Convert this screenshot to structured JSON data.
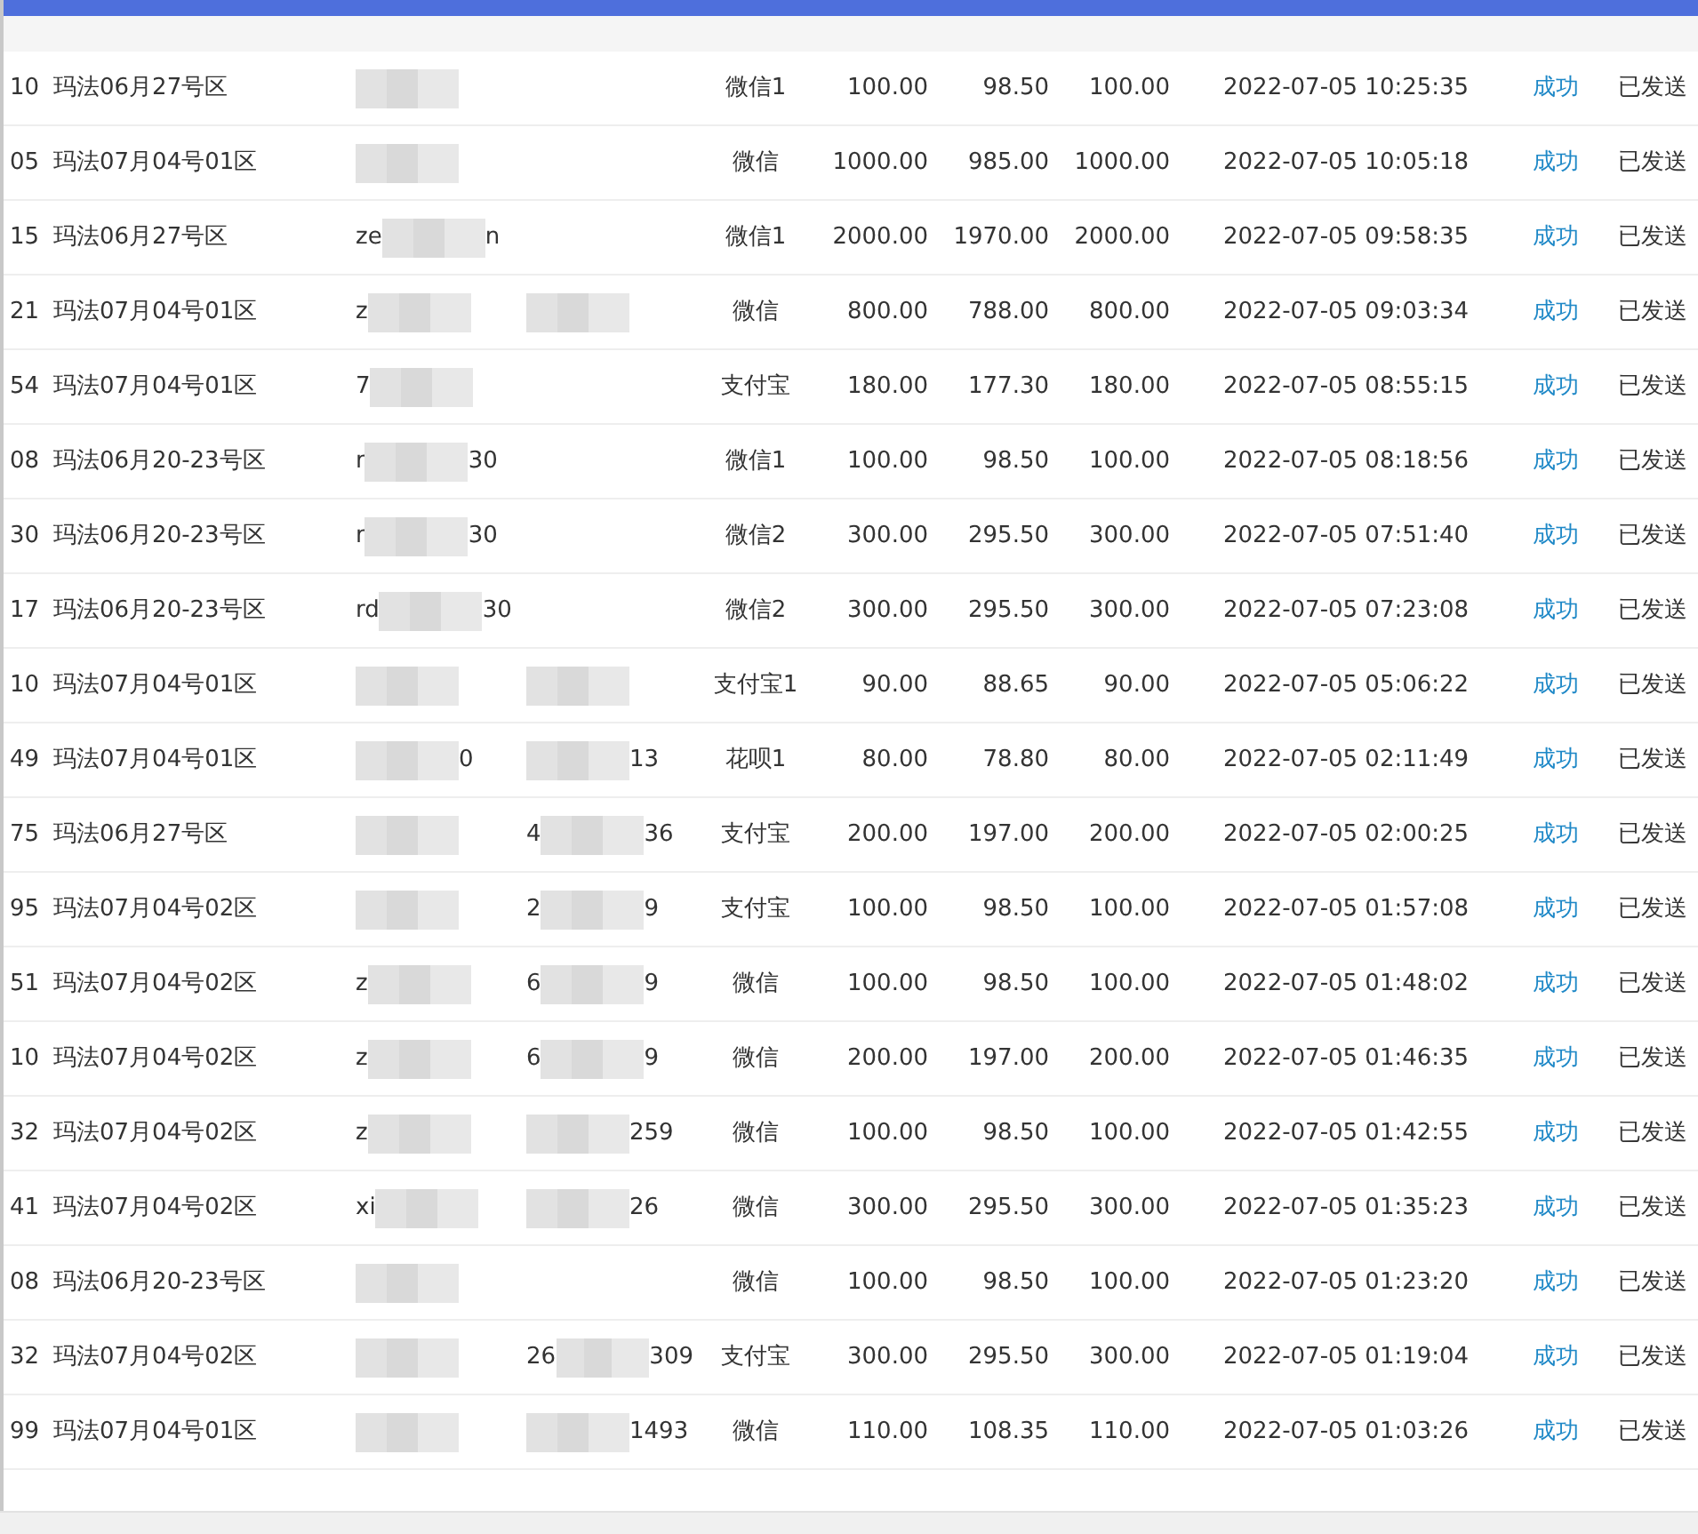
{
  "rows": [
    {
      "id": "10",
      "zone": "玛法06月27号区",
      "account": {
        "masked": true
      },
      "method": "微信1",
      "amount": "100.00",
      "actual": "98.50",
      "paid": "100.00",
      "time": "2022-07-05 10:25:35",
      "status": "成功",
      "notify": "已发送"
    },
    {
      "id": "05",
      "zone": "玛法07月04号01区",
      "account": {
        "masked": true
      },
      "method": "微信",
      "amount": "1000.00",
      "actual": "985.00",
      "paid": "1000.00",
      "time": "2022-07-05 10:05:18",
      "status": "成功",
      "notify": "已发送"
    },
    {
      "id": "15",
      "zone": "玛法06月27号区",
      "account": {
        "start": "ze",
        "end": "n",
        "masked": true
      },
      "method": "微信1",
      "amount": "2000.00",
      "actual": "1970.00",
      "paid": "2000.00",
      "time": "2022-07-05 09:58:35",
      "status": "成功",
      "notify": "已发送"
    },
    {
      "id": "21",
      "zone": "玛法07月04号01区",
      "account": {
        "start": "z",
        "masked": true
      },
      "phone": {
        "masked": true
      },
      "method": "微信",
      "amount": "800.00",
      "actual": "788.00",
      "paid": "800.00",
      "time": "2022-07-05 09:03:34",
      "status": "成功",
      "notify": "已发送"
    },
    {
      "id": "54",
      "zone": "玛法07月04号01区",
      "account": {
        "start": "7",
        "masked": true
      },
      "method": "支付宝",
      "amount": "180.00",
      "actual": "177.30",
      "paid": "180.00",
      "time": "2022-07-05 08:55:15",
      "status": "成功",
      "notify": "已发送"
    },
    {
      "id": "08",
      "zone": "玛法06月20-23号区",
      "account": {
        "start": "r",
        "end": "30",
        "masked": true
      },
      "method": "微信1",
      "amount": "100.00",
      "actual": "98.50",
      "paid": "100.00",
      "time": "2022-07-05 08:18:56",
      "status": "成功",
      "notify": "已发送"
    },
    {
      "id": "30",
      "zone": "玛法06月20-23号区",
      "account": {
        "start": "r",
        "end": "30",
        "masked": true
      },
      "method": "微信2",
      "amount": "300.00",
      "actual": "295.50",
      "paid": "300.00",
      "time": "2022-07-05 07:51:40",
      "status": "成功",
      "notify": "已发送"
    },
    {
      "id": "17",
      "zone": "玛法06月20-23号区",
      "account": {
        "start": "rd",
        "end": "30",
        "masked": true
      },
      "method": "微信2",
      "amount": "300.00",
      "actual": "295.50",
      "paid": "300.00",
      "time": "2022-07-05 07:23:08",
      "status": "成功",
      "notify": "已发送"
    },
    {
      "id": "10",
      "zone": "玛法07月04号01区",
      "account": {
        "masked": true
      },
      "phone": {
        "masked": true
      },
      "method": "支付宝1",
      "amount": "90.00",
      "actual": "88.65",
      "paid": "90.00",
      "time": "2022-07-05 05:06:22",
      "status": "成功",
      "notify": "已发送"
    },
    {
      "id": "49",
      "zone": "玛法07月04号01区",
      "account": {
        "end": "0",
        "masked": true
      },
      "phone": {
        "end": "13",
        "masked": true
      },
      "method": "花呗1",
      "amount": "80.00",
      "actual": "78.80",
      "paid": "80.00",
      "time": "2022-07-05 02:11:49",
      "status": "成功",
      "notify": "已发送"
    },
    {
      "id": "75",
      "zone": "玛法06月27号区",
      "account": {
        "masked": true
      },
      "phone": {
        "start": "4",
        "end": "36",
        "masked": true
      },
      "method": "支付宝",
      "amount": "200.00",
      "actual": "197.00",
      "paid": "200.00",
      "time": "2022-07-05 02:00:25",
      "status": "成功",
      "notify": "已发送"
    },
    {
      "id": "95",
      "zone": "玛法07月04号02区",
      "account": {
        "masked": true
      },
      "phone": {
        "start": "2",
        "end": "9",
        "masked": true
      },
      "method": "支付宝",
      "amount": "100.00",
      "actual": "98.50",
      "paid": "100.00",
      "time": "2022-07-05 01:57:08",
      "status": "成功",
      "notify": "已发送"
    },
    {
      "id": "51",
      "zone": "玛法07月04号02区",
      "account": {
        "start": "z",
        "masked": true
      },
      "phone": {
        "start": "6",
        "end": "9",
        "masked": true
      },
      "method": "微信",
      "amount": "100.00",
      "actual": "98.50",
      "paid": "100.00",
      "time": "2022-07-05 01:48:02",
      "status": "成功",
      "notify": "已发送"
    },
    {
      "id": "10",
      "zone": "玛法07月04号02区",
      "account": {
        "start": "z",
        "masked": true
      },
      "phone": {
        "start": "6",
        "end": "9",
        "masked": true
      },
      "method": "微信",
      "amount": "200.00",
      "actual": "197.00",
      "paid": "200.00",
      "time": "2022-07-05 01:46:35",
      "status": "成功",
      "notify": "已发送"
    },
    {
      "id": "32",
      "zone": "玛法07月04号02区",
      "account": {
        "start": "z",
        "masked": true
      },
      "phone": {
        "end": "259",
        "masked": true
      },
      "method": "微信",
      "amount": "100.00",
      "actual": "98.50",
      "paid": "100.00",
      "time": "2022-07-05 01:42:55",
      "status": "成功",
      "notify": "已发送"
    },
    {
      "id": "41",
      "zone": "玛法07月04号02区",
      "account": {
        "start": "xi",
        "masked": true
      },
      "phone": {
        "end": "26",
        "masked": true
      },
      "method": "微信",
      "amount": "300.00",
      "actual": "295.50",
      "paid": "300.00",
      "time": "2022-07-05 01:35:23",
      "status": "成功",
      "notify": "已发送"
    },
    {
      "id": "08",
      "zone": "玛法06月20-23号区",
      "account": {
        "masked": true
      },
      "method": "微信",
      "amount": "100.00",
      "actual": "98.50",
      "paid": "100.00",
      "time": "2022-07-05 01:23:20",
      "status": "成功",
      "notify": "已发送"
    },
    {
      "id": "32",
      "zone": "玛法07月04号02区",
      "account": {
        "masked": true
      },
      "phone": {
        "start": "26",
        "end": "309",
        "masked": true
      },
      "method": "支付宝",
      "amount": "300.00",
      "actual": "295.50",
      "paid": "300.00",
      "time": "2022-07-05 01:19:04",
      "status": "成功",
      "notify": "已发送"
    },
    {
      "id": "99",
      "zone": "玛法07月04号01区",
      "account": {
        "masked": true
      },
      "phone": {
        "end": "1493",
        "masked": true
      },
      "method": "微信",
      "amount": "110.00",
      "actual": "108.35",
      "paid": "110.00",
      "time": "2022-07-05 01:03:26",
      "status": "成功",
      "notify": "已发送"
    }
  ]
}
